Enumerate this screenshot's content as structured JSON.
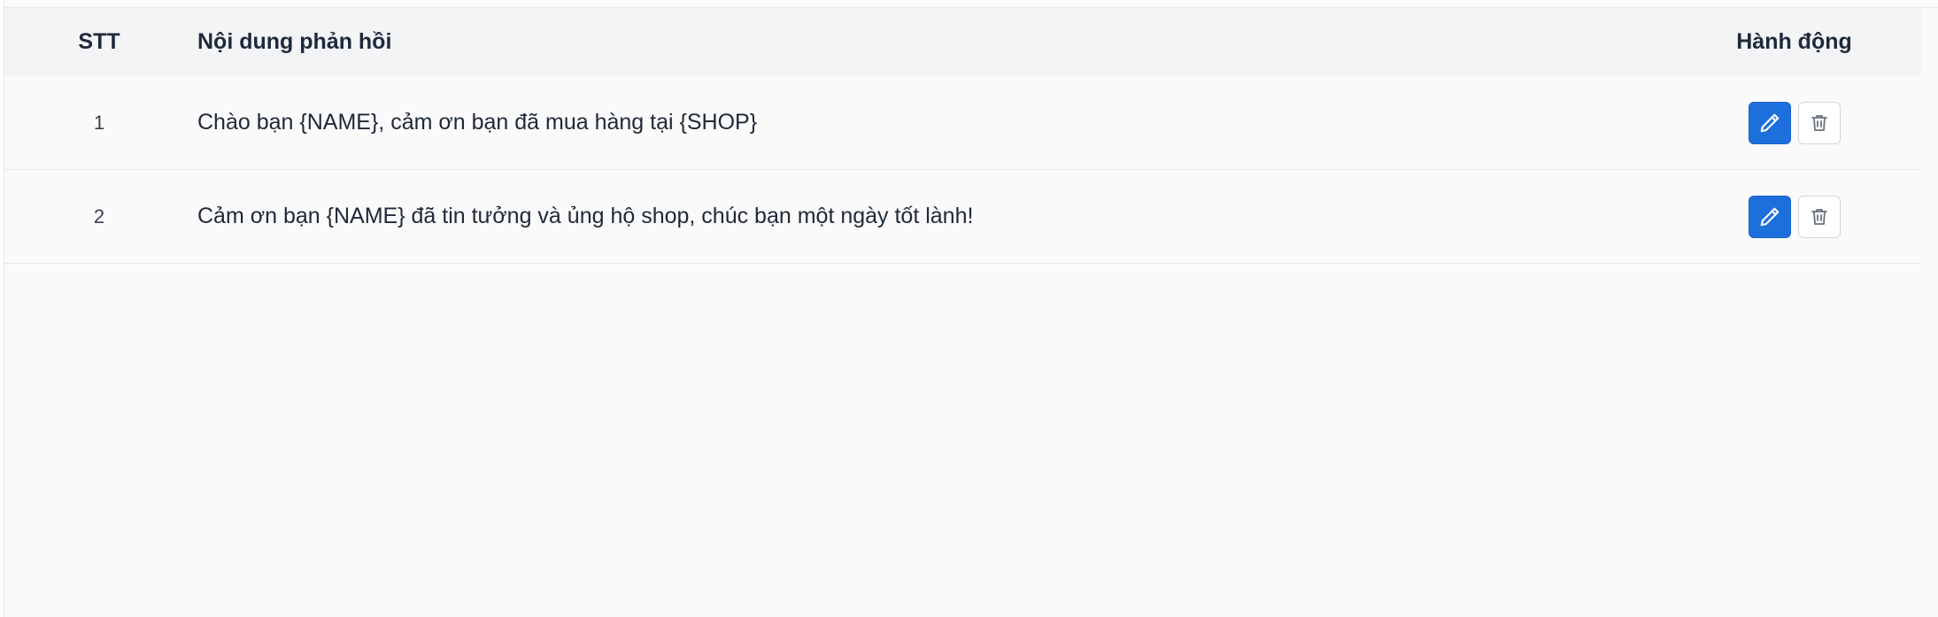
{
  "table": {
    "headers": {
      "stt": "STT",
      "content": "Nội dung phản hồi",
      "action": "Hành động"
    },
    "rows": [
      {
        "stt": "1",
        "content": "Chào bạn {NAME}, cảm ơn bạn đã mua hàng tại {SHOP}"
      },
      {
        "stt": "2",
        "content": "Cảm ơn bạn {NAME} đã tin tưởng và ủng hộ shop, chúc bạn một ngày tốt lành!"
      }
    ]
  },
  "icons": {
    "edit": "pencil-icon",
    "delete": "trash-icon"
  },
  "colors": {
    "primary": "#1d6fdc",
    "header_bg": "#f3f4f6",
    "page_bg": "#fafafa",
    "border": "#e5e7eb"
  }
}
